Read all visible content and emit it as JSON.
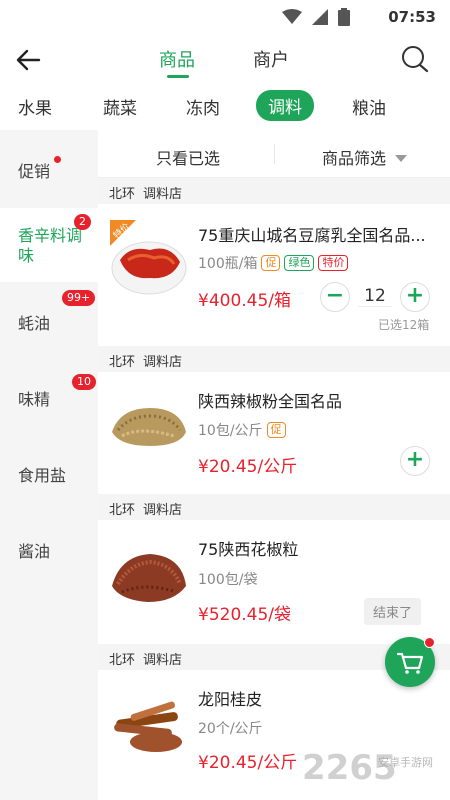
{
  "status": {
    "time": "07:53"
  },
  "header": {
    "tabs": [
      {
        "label": "商品",
        "active": true
      },
      {
        "label": "商户",
        "active": false
      }
    ]
  },
  "categories": [
    {
      "label": "水果"
    },
    {
      "label": "蔬菜"
    },
    {
      "label": "冻肉"
    },
    {
      "label": "调料",
      "active": true
    },
    {
      "label": "粮油"
    }
  ],
  "sidebar": {
    "items": [
      {
        "label": "促销",
        "dot": true
      },
      {
        "label": "香辛料调味",
        "badge": "2",
        "active": true
      },
      {
        "label": "蚝油",
        "badge": "99+"
      },
      {
        "label": "味精",
        "badge": "10"
      },
      {
        "label": "食用盐"
      },
      {
        "label": "酱油"
      }
    ]
  },
  "filter": {
    "only_selected": "只看已选",
    "filter_label": "商品筛选"
  },
  "products": [
    {
      "shop": [
        "北环",
        "调料店"
      ],
      "ribbon": "特价",
      "name": "75重庆山城名豆腐乳全国名品...",
      "spec": "100瓶/箱",
      "tags": [
        {
          "text": "促",
          "color": "orange"
        },
        {
          "text": "绿色",
          "color": "green"
        },
        {
          "text": "特价",
          "color": "red"
        }
      ],
      "price": "¥400.45/箱",
      "qty": "12",
      "selected_note": "已选12箱"
    },
    {
      "shop": [
        "北环",
        "调料店"
      ],
      "name": "陕西辣椒粉全国名品",
      "spec": "10包/公斤",
      "tags": [
        {
          "text": "促",
          "color": "orange"
        }
      ],
      "price": "¥20.45/公斤"
    },
    {
      "shop": [
        "北环",
        "调料店"
      ],
      "name": "75陕西花椒粒",
      "spec": "100包/袋",
      "tags": [],
      "price": "¥520.45/袋",
      "ended_label": "结束了"
    },
    {
      "shop": [
        "北环",
        "调料店"
      ],
      "name": "龙阳桂皮",
      "spec": "20个/公斤",
      "tags": [],
      "price": "¥20.45/公斤"
    }
  ],
  "watermark": {
    "main": "2265",
    "sub": "安卓手游网"
  },
  "colors": {
    "accent": "#1ea55a",
    "price": "#e8222d",
    "badge": "#e8222d"
  }
}
